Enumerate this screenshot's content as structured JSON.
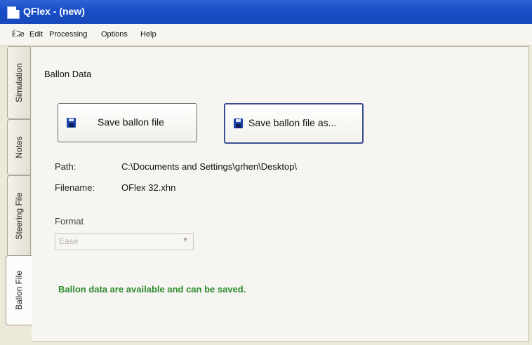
{
  "window": {
    "title": "QFlex - (new)"
  },
  "menu": [
    {
      "label": "File"
    },
    {
      "label": "Edit"
    },
    {
      "label": "Processing"
    },
    {
      "label": "Options"
    },
    {
      "label": "Help"
    }
  ],
  "side_tabs": [
    {
      "label": "Simulation"
    },
    {
      "label": "Notes"
    },
    {
      "label": "Steering File"
    },
    {
      "label": "Ballon File"
    }
  ],
  "panel": {
    "title": "Ballon Data",
    "save_button": "Save ballon file",
    "save_as_button": "Save ballon file as...",
    "path_label": "Path:",
    "path_value": "C:\\Documents and Settings\\grhen\\Desktop\\",
    "filename_label": "Filename:",
    "filename_value": "OFlex 32.xhn",
    "format_label": "Format",
    "format_value": "Ease",
    "status": "Ballon data are available and can be saved."
  },
  "colors": {
    "titlebar": "#1b4fc8",
    "status_text": "#2e8b2e"
  },
  "icons": {
    "save": "floppy-disk-icon",
    "select": "chevron-down-icon",
    "cursor": "mouse-pointer-icon"
  }
}
